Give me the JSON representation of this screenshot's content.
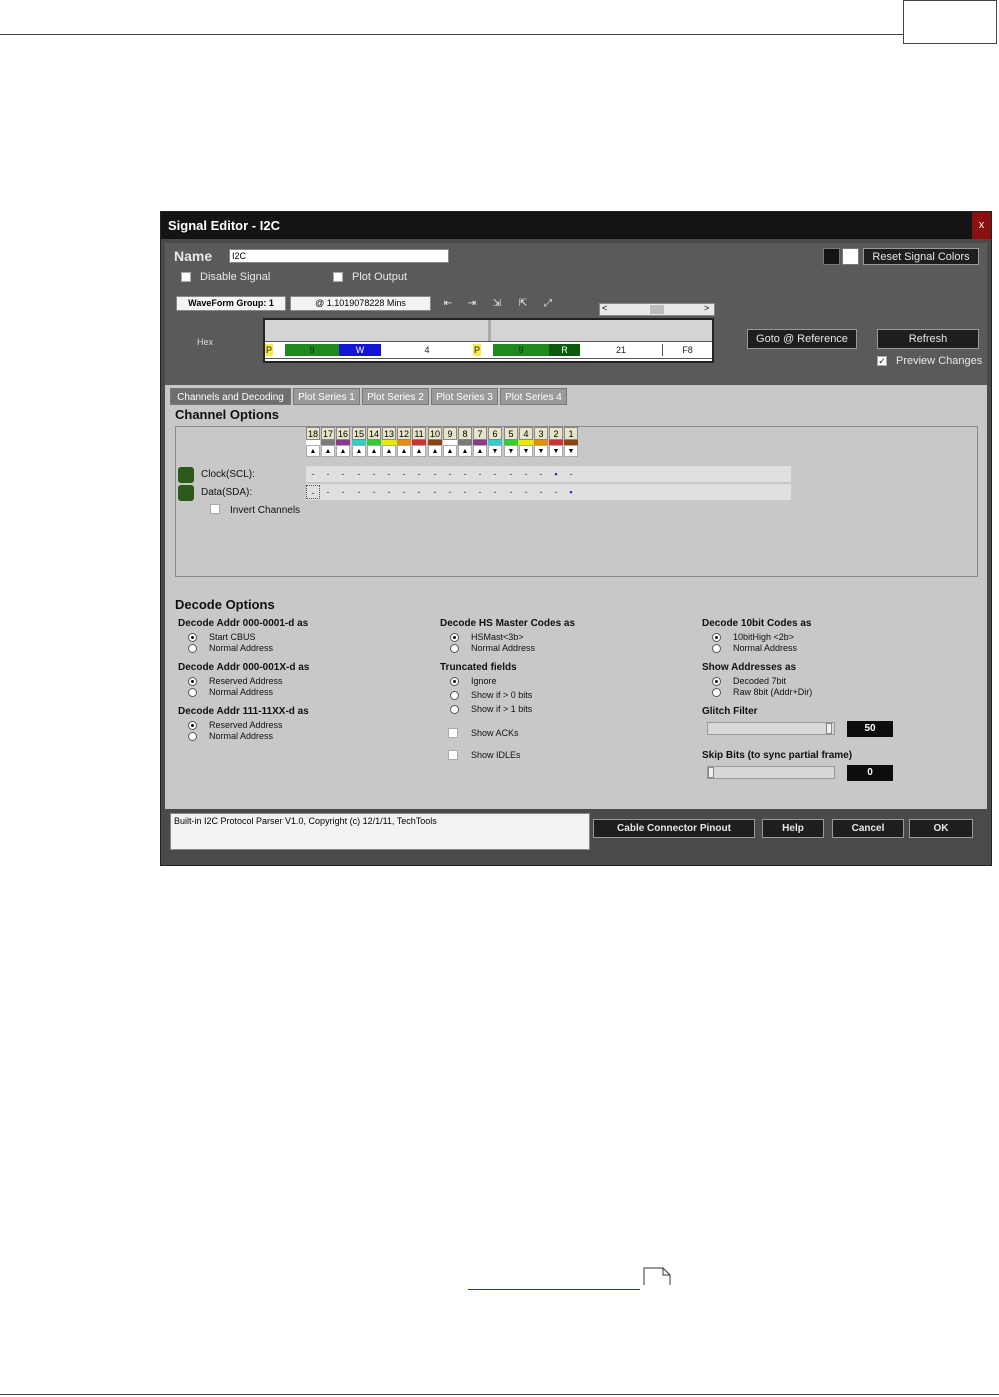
{
  "dialog": {
    "title": "Signal Editor - I2C",
    "close_label": "x",
    "name_label": "Name",
    "name_value": "I2C",
    "reset_colors_label": "Reset Signal Colors",
    "disable_signal_label": "Disable Signal",
    "plot_output_label": "Plot Output",
    "waveform_group_label": "WaveForm Group: 1",
    "time_label": "@ 1.1019078228 Mins",
    "scroll_left": "<",
    "scroll_right": ">",
    "hex_label": "Hex",
    "wave_segments": [
      "P",
      "9",
      "W",
      "4",
      "P",
      "9",
      "R",
      "21",
      "F8"
    ],
    "goto_reference_label": "Goto @ Reference",
    "refresh_label": "Refresh",
    "preview_changes_label": "Preview Changes",
    "preview_checked": true,
    "icons": [
      "trigger-start-icon",
      "trigger-end-icon",
      "zoom-in-icon",
      "zoom-out-icon",
      "zoom-fit-icon"
    ]
  },
  "tabs": [
    "Channels and Decoding",
    "Plot Series 1",
    "Plot Series 2",
    "Plot Series 3",
    "Plot Series 4"
  ],
  "channel_options": {
    "title": "Channel Options",
    "channel_numbers": [
      "18",
      "17",
      "16",
      "15",
      "14",
      "13",
      "12",
      "11",
      "10",
      "9",
      "8",
      "7",
      "6",
      "5",
      "4",
      "3",
      "2",
      "1"
    ],
    "channel_colors": [
      "#ffffff",
      "#7a7a7a",
      "#8b3a8b",
      "#33cccc",
      "#33cc33",
      "#e6e619",
      "#e68c19",
      "#cc3333",
      "#8b4513",
      "#ffffff",
      "#7a7a7a",
      "#8b3a8b",
      "#33cccc",
      "#33cc33",
      "#e6e619",
      "#e68c19",
      "#cc3333",
      "#8b4513"
    ],
    "channel_arrows": [
      "▲",
      "▲",
      "▲",
      "▲",
      "▲",
      "▲",
      "▲",
      "▲",
      "▲",
      "▲",
      "▲",
      "▲",
      "▼",
      "▼",
      "▼",
      "▼",
      "▼",
      "▼"
    ],
    "clock_label": "Clock(SCL):",
    "data_label": "Data(SDA):",
    "invert_channels_label": "Invert Channels",
    "clock_dash": "-",
    "data_dash": "-",
    "selected_mark": "▪"
  },
  "decode_options": {
    "title": "Decode Options",
    "col1": [
      {
        "title": "Decode Addr 000-0001-d as",
        "options": [
          "Start CBUS",
          "Normal Address"
        ],
        "selected": 0
      },
      {
        "title": "Decode Addr 000-001X-d as",
        "options": [
          "Reserved Address",
          "Normal Address"
        ],
        "selected": 0
      },
      {
        "title": "Decode Addr 111-11XX-d as",
        "options": [
          "Reserved Address",
          "Normal Address"
        ],
        "selected": 0
      }
    ],
    "col2": [
      {
        "title": "Decode HS Master Codes as",
        "options": [
          "HSMast<3b>",
          "Normal Address"
        ],
        "selected": 0
      },
      {
        "title": "Truncated fields",
        "options": [
          "Ignore",
          "Show if > 0 bits",
          "Show if > 1 bits"
        ],
        "selected": 0
      }
    ],
    "show_acks_label": "Show ACKs",
    "show_idles_label": "Show IDLEs",
    "col3": [
      {
        "title": "Decode 10bit Codes as",
        "options": [
          "10bitHigh <2b>",
          "Normal Address"
        ],
        "selected": 0
      },
      {
        "title": "Show Addresses as",
        "options": [
          "Decoded 7bit",
          "Raw 8bit (Addr+Dir)"
        ],
        "selected": 0
      }
    ],
    "glitch_filter_label": "Glitch Filter",
    "glitch_filter_value": "50",
    "glitch_filter_level": 0.98,
    "skip_bits_label": "Skip Bits (to sync partial frame)",
    "skip_bits_value": "0",
    "skip_bits_level": 0.0
  },
  "footer": {
    "status_text": "Built-in I2C Protocol Parser V1.0,  Copyright (c) 12/1/11, TechTools",
    "cable_pinout_label": "Cable Connector Pinout",
    "help_label": "Help",
    "cancel_label": "Cancel",
    "ok_label": "OK"
  }
}
